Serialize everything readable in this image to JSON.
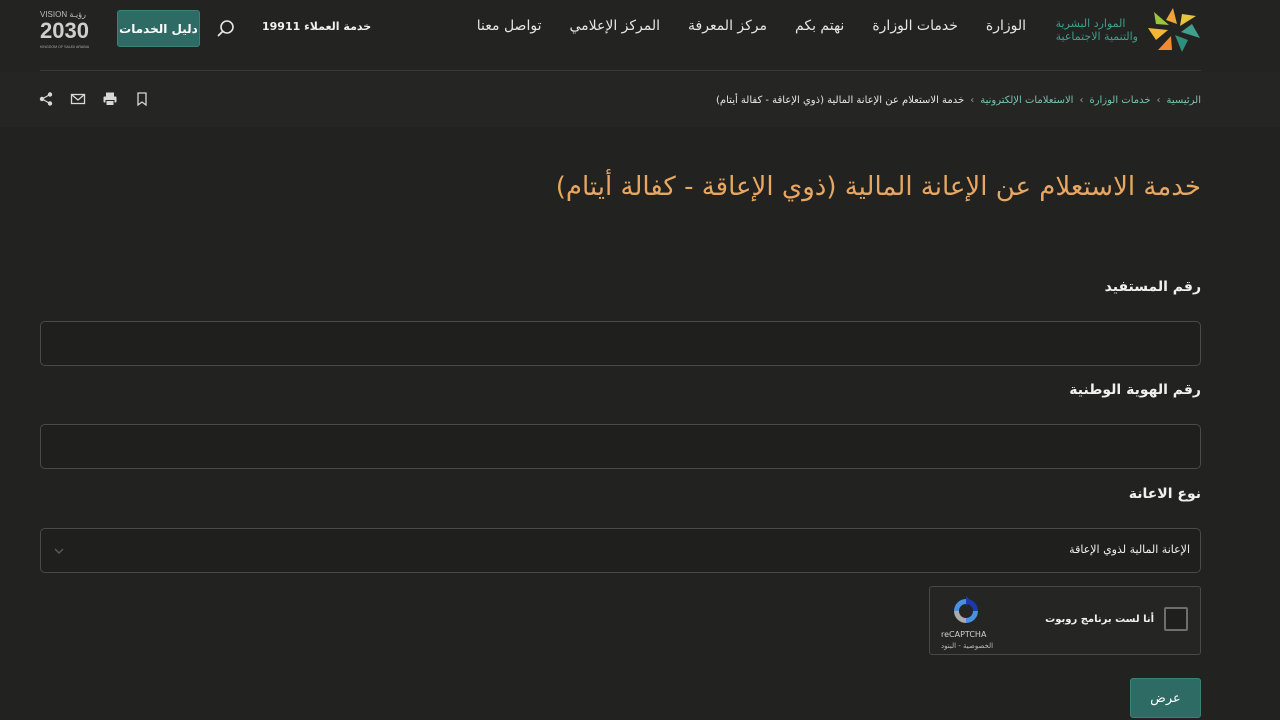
{
  "header": {
    "logo_line1": "الموارد البشرية",
    "logo_line2": "والتنمية الاجتماعية",
    "nav": [
      {
        "label": "الوزارة"
      },
      {
        "label": "خدمات الوزارة"
      },
      {
        "label": "نهتم بكم"
      },
      {
        "label": "مركز المعرفة"
      },
      {
        "label": "المركز الإعلامي"
      },
      {
        "label": "تواصل معنا"
      }
    ],
    "customer_service": "خدمة العملاء 19911",
    "guide_button": "دليل الخدمات",
    "vision_top": "VISION رؤيـة",
    "vision_year": "2030",
    "vision_sub": "KINGDOM OF SAUDI ARABIA"
  },
  "breadcrumb": {
    "items": [
      "الرئيسية",
      "خدمات الوزارة",
      "الاستعلامات الإلكترونية"
    ],
    "current": "خدمة الاستعلام عن الإعانة المالية (ذوي الإعاقة - كفالة أيتام)",
    "separator": "›"
  },
  "tools": [
    "share-icon",
    "mail-icon",
    "print-icon",
    "bookmark-icon"
  ],
  "main": {
    "title": "خدمة الاستعلام عن الإعانة المالية (ذوي الإعاقة - كفالة أيتام)",
    "beneficiary_label": "رقم المستفيد",
    "beneficiary_value": "",
    "national_id_label": "رقم الهوية الوطنية",
    "national_id_value": "",
    "aid_type_label": "نوع الاعانة",
    "aid_type_selected": "الإعانة المالية لذوي الإعاقة",
    "captcha_text": "أنا لست برنامج روبوت",
    "captcha_brand": "reCAPTCHA",
    "captcha_links": "الخصوصية - البنود",
    "submit_label": "عرض"
  },
  "colors": {
    "background": "#222220",
    "accent": "#2e6b64",
    "title": "#e8a660",
    "link": "#79c2b2"
  }
}
